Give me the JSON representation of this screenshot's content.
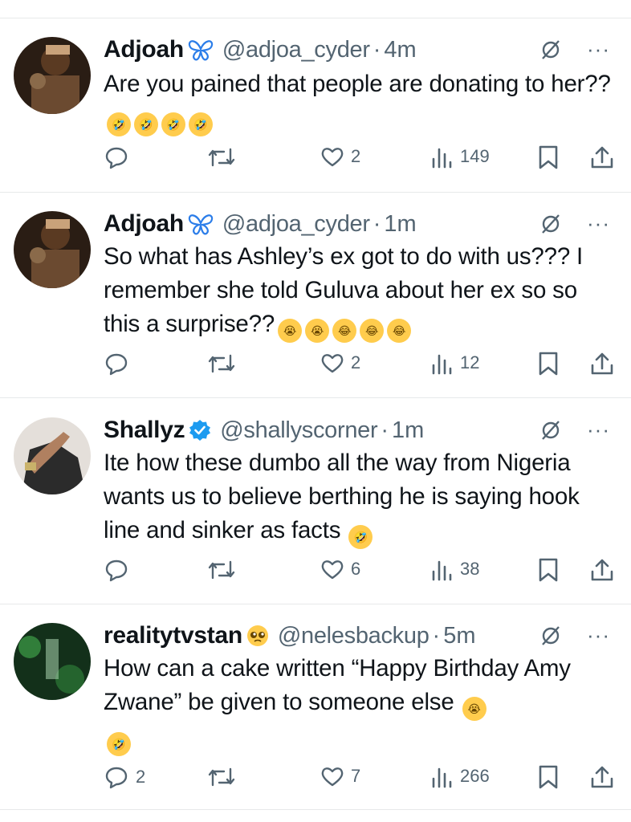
{
  "tweets": [
    {
      "name": "Adjoah",
      "badge_icon": "butterfly-icon",
      "handle": "@adjoa_cyder",
      "separator": "·",
      "time": "4m",
      "text": "Are you pained that people are donating to her??",
      "emojis": [
        "rofl-emoji",
        "rofl-emoji",
        "rofl-emoji",
        "rofl-emoji"
      ],
      "replies": "",
      "retweets": "",
      "likes": "2",
      "views": "149",
      "avatar_color": "#3a2a1e"
    },
    {
      "name": "Adjoah",
      "badge_icon": "butterfly-icon",
      "handle": "@adjoa_cyder",
      "separator": "·",
      "time": "1m",
      "text": "So what has Ashley’s ex got to do with us??? I remember she told Guluva about her ex so so this a surprise??",
      "emojis": [
        "loudly-crying-emoji",
        "loudly-crying-emoji",
        "joy-emoji",
        "joy-emoji",
        "joy-emoji"
      ],
      "replies": "",
      "retweets": "",
      "likes": "2",
      "views": "12",
      "avatar_color": "#3a2a1e"
    },
    {
      "name": "Shallyz",
      "badge_icon": "verified-badge-icon",
      "handle": "@shallyscorner",
      "separator": "·",
      "time": "1m",
      "text": "Ite how these dumbo all the way from Nigeria wants us to believe berthing he is saying hook line and sinker as facts",
      "emojis": [
        "rofl-emoji"
      ],
      "replies": "",
      "retweets": "",
      "likes": "6",
      "views": "38",
      "avatar_color": "#d9d4cf"
    },
    {
      "name": "realitytvstan",
      "badge_icon": "pleading-face-emoji",
      "handle": "@nelesbackup",
      "separator": "·",
      "time": "5m",
      "text": "How can a cake written “Happy Birthday Amy Zwane” be given to someone else",
      "emojis": [
        "loudly-crying-emoji",
        "rofl-emoji"
      ],
      "replies": "2",
      "retweets": "",
      "likes": "7",
      "views": "266",
      "avatar_color": "#1f3a22"
    }
  ],
  "colors": {
    "text": "#0f1419",
    "secondary": "#536471",
    "verified": "#1d9bf0",
    "butterfly": "#2b7de9",
    "divider": "#e7e9ea"
  },
  "more_label": "···"
}
